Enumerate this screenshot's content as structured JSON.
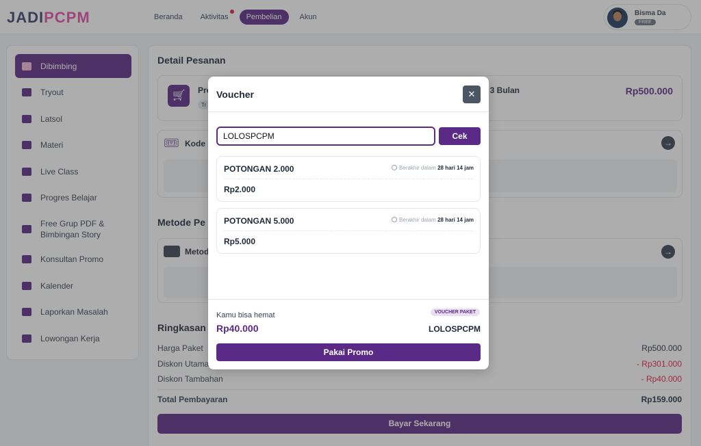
{
  "header": {
    "logo_part1": "JADI",
    "logo_part2": "PCPM",
    "nav": [
      {
        "label": "Beranda"
      },
      {
        "label": "Aktivitas"
      },
      {
        "label": "Pembelian"
      },
      {
        "label": "Akun"
      }
    ],
    "profile": {
      "name": "Bisma Da",
      "badge": "FREE"
    }
  },
  "sidebar": {
    "items": [
      {
        "label": "Dibimbing"
      },
      {
        "label": "Tryout"
      },
      {
        "label": "Latsol"
      },
      {
        "label": "Materi"
      },
      {
        "label": "Live Class"
      },
      {
        "label": "Progres Belajar"
      },
      {
        "label": "Free Grup PDF & Bimbingan Story"
      },
      {
        "label": "Konsultan Promo"
      },
      {
        "label": "Kalender"
      },
      {
        "label": "Laporkan Masalah"
      },
      {
        "label": "Lowongan Kerja"
      }
    ]
  },
  "main": {
    "detail_title": "Detail Pesanan",
    "product_prefix": "Pro",
    "product_suffix": "if 3 Bulan",
    "product_tag": "Tr",
    "product_price": "Rp500.000",
    "kode_label": "Kode P",
    "metode_title": "Metode Pe",
    "metode_label": "Metod",
    "ringkasan_title": "Ringkasan P",
    "rows": [
      {
        "label": "Harga Paket",
        "value": "Rp500.000"
      },
      {
        "label": "Diskon Utama",
        "value": "- Rp301.000"
      },
      {
        "label": "Diskon Tambahan",
        "value": "- Rp40.000"
      },
      {
        "label": "Total Pembayaran",
        "value": "Rp159.000"
      }
    ],
    "pay_button": "Bayar Sekarang"
  },
  "modal": {
    "title": "Voucher",
    "input_value": "LOLOSPCPM",
    "cek_button": "Cek",
    "vouchers": [
      {
        "name": "POTONGAN 2.000",
        "expiry_prefix": "Berakhir dalam",
        "expiry": "28 hari 14 jam",
        "value": "Rp2.000"
      },
      {
        "name": "POTONGAN 5.000",
        "expiry_prefix": "Berakhir dalam",
        "expiry": "28 hari 14 jam",
        "value": "Rp5.000"
      }
    ],
    "save_label": "Kamu bisa hemat",
    "save_value": "Rp40.000",
    "voucher_tag": "VOUCHER PAKET",
    "voucher_code": "LOLOSPCPM",
    "apply_button": "Pakai Promo"
  }
}
